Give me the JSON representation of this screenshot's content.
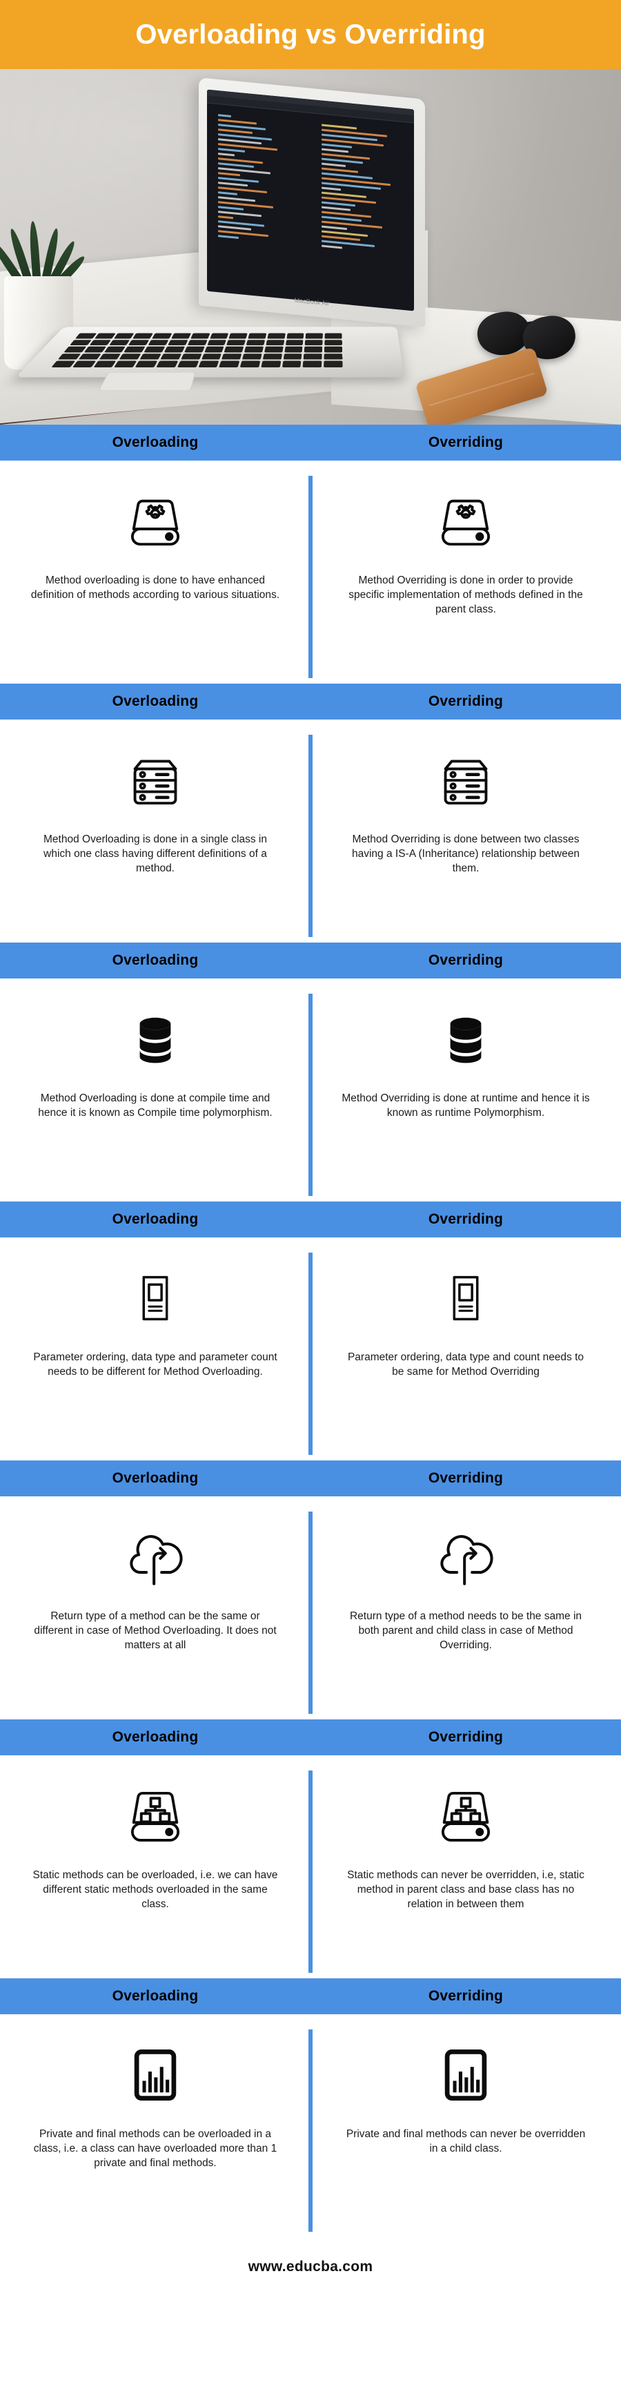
{
  "header": {
    "title": "Overloading vs Overriding",
    "background_color": "#f2a525",
    "title_color": "#ffffff"
  },
  "hero": {
    "alt": "laptop-with-code-on-desk-photo",
    "laptop_brand": "MacBook Air"
  },
  "theme": {
    "band_color": "#4a90e2",
    "divider_color": "#4a90e2",
    "text_color": "#1c1c1c"
  },
  "column_headers": {
    "left": "Overloading",
    "right": "Overriding"
  },
  "sections": [
    {
      "icon": "gear-machine-icon",
      "left_text": "Method overloading is done to have enhanced definition of methods according to various situations.",
      "right_text": "Method Overriding is done in order to provide specific implementation of methods defined in the parent class."
    },
    {
      "icon": "server-rack-icon",
      "left_text": "Method Overloading is done in a single class in which one class having different definitions of a method.",
      "right_text": "Method Overriding is done between two classes having a IS-A (Inheritance) relationship between them."
    },
    {
      "icon": "database-icon",
      "left_text": "Method Overloading is done at compile time and hence it is known as Compile time polymorphism.",
      "right_text": "Method Overriding is done at runtime and hence it is known as runtime Polymorphism."
    },
    {
      "icon": "document-card-icon",
      "left_text": "Parameter ordering, data type and parameter count needs to be different for Method Overloading.",
      "right_text": "Parameter ordering, data type and count needs to be same for Method Overriding"
    },
    {
      "icon": "cloud-upload-icon",
      "left_text": "Return type of a method can be the same or different in case of Method Overloading. It does not matters at all",
      "right_text": "Return type of a method needs to be the same in both parent and child class in case of Method Overriding."
    },
    {
      "icon": "network-hierarchy-machine-icon",
      "left_text": "Static methods can be overloaded, i.e. we can have different static methods overloaded in the same class.",
      "right_text": "Static methods can never be overridden, i.e, static method in parent class and base class has no relation in between them"
    },
    {
      "icon": "bar-chart-icon",
      "left_text": "Private and final methods can be overloaded in a class, i.e. a class can have overloaded more than 1 private and final methods.",
      "right_text": "Private and final methods can never be overridden in a child class."
    }
  ],
  "footer": {
    "url": "www.educba.com"
  }
}
